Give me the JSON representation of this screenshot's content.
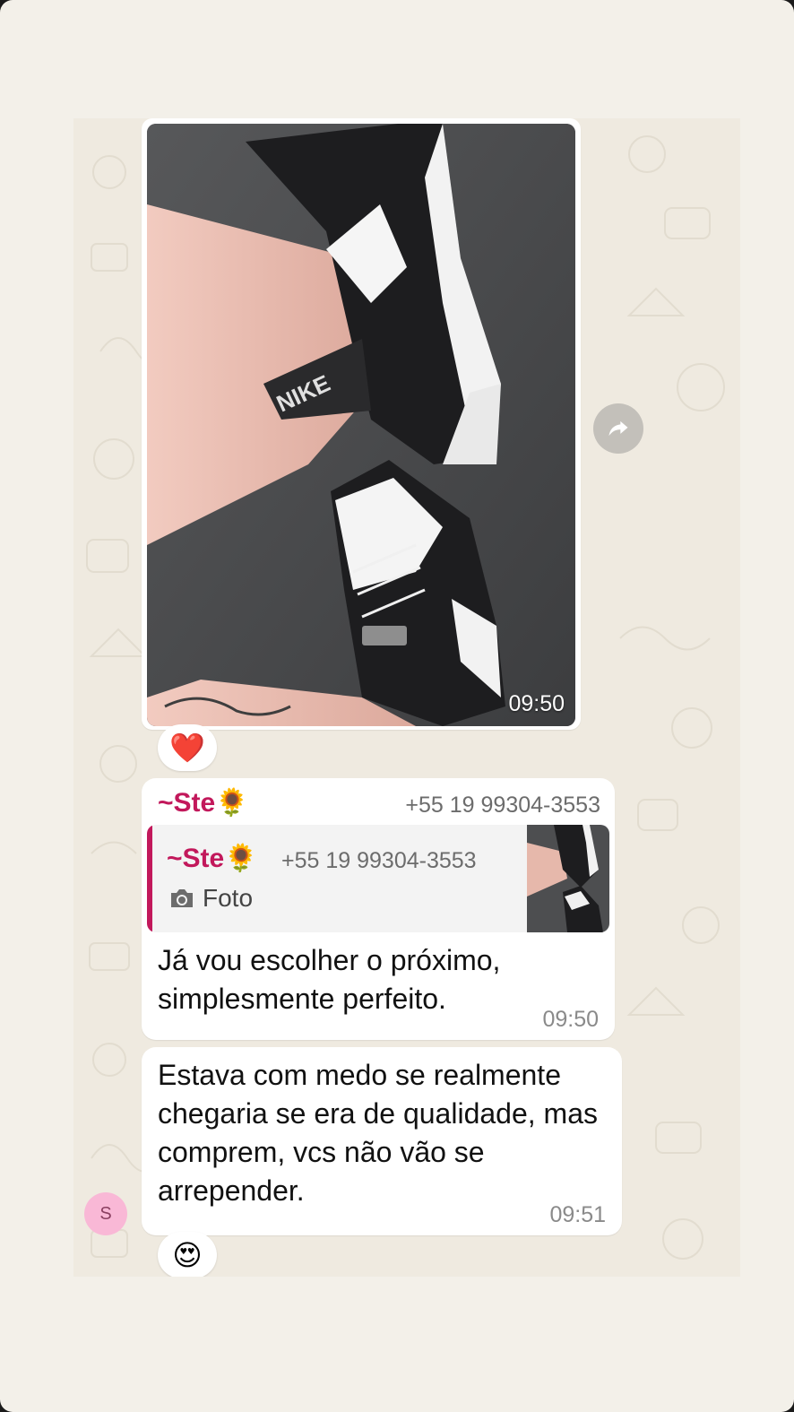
{
  "messages": [
    {
      "type": "image",
      "image_description": "Photo of a person's legs wearing black and white Nike Dunk Low sneakers on an asphalt surface",
      "brand_label": "NIKE",
      "time": "09:50",
      "reaction": "❤️"
    },
    {
      "type": "reply",
      "sender": "~Ste🌻",
      "phone": "+55 19 99304-3553",
      "quoted": {
        "sender": "~Ste🌻",
        "phone": "+55 19 99304-3553",
        "kind": "Foto"
      },
      "text": "Já vou escolher o próximo, simplesmente perfeito.",
      "time": "09:50"
    },
    {
      "type": "text",
      "text": "Estava com medo se realmente chegaria se era de qualidade, mas comprem, vcs não vão se arrepender.",
      "time": "09:51",
      "reaction": "😍"
    }
  ],
  "avatar": {
    "initial": "S",
    "color": "#f9b8d6"
  },
  "icons": {
    "forward": "forward-icon",
    "camera": "camera-icon",
    "flower": "sunflower-emoji"
  },
  "colors": {
    "sender": "#c2185b",
    "quote_bar": "#c2185b",
    "chat_bg": "#efeae0",
    "bubble": "#ffffff"
  }
}
